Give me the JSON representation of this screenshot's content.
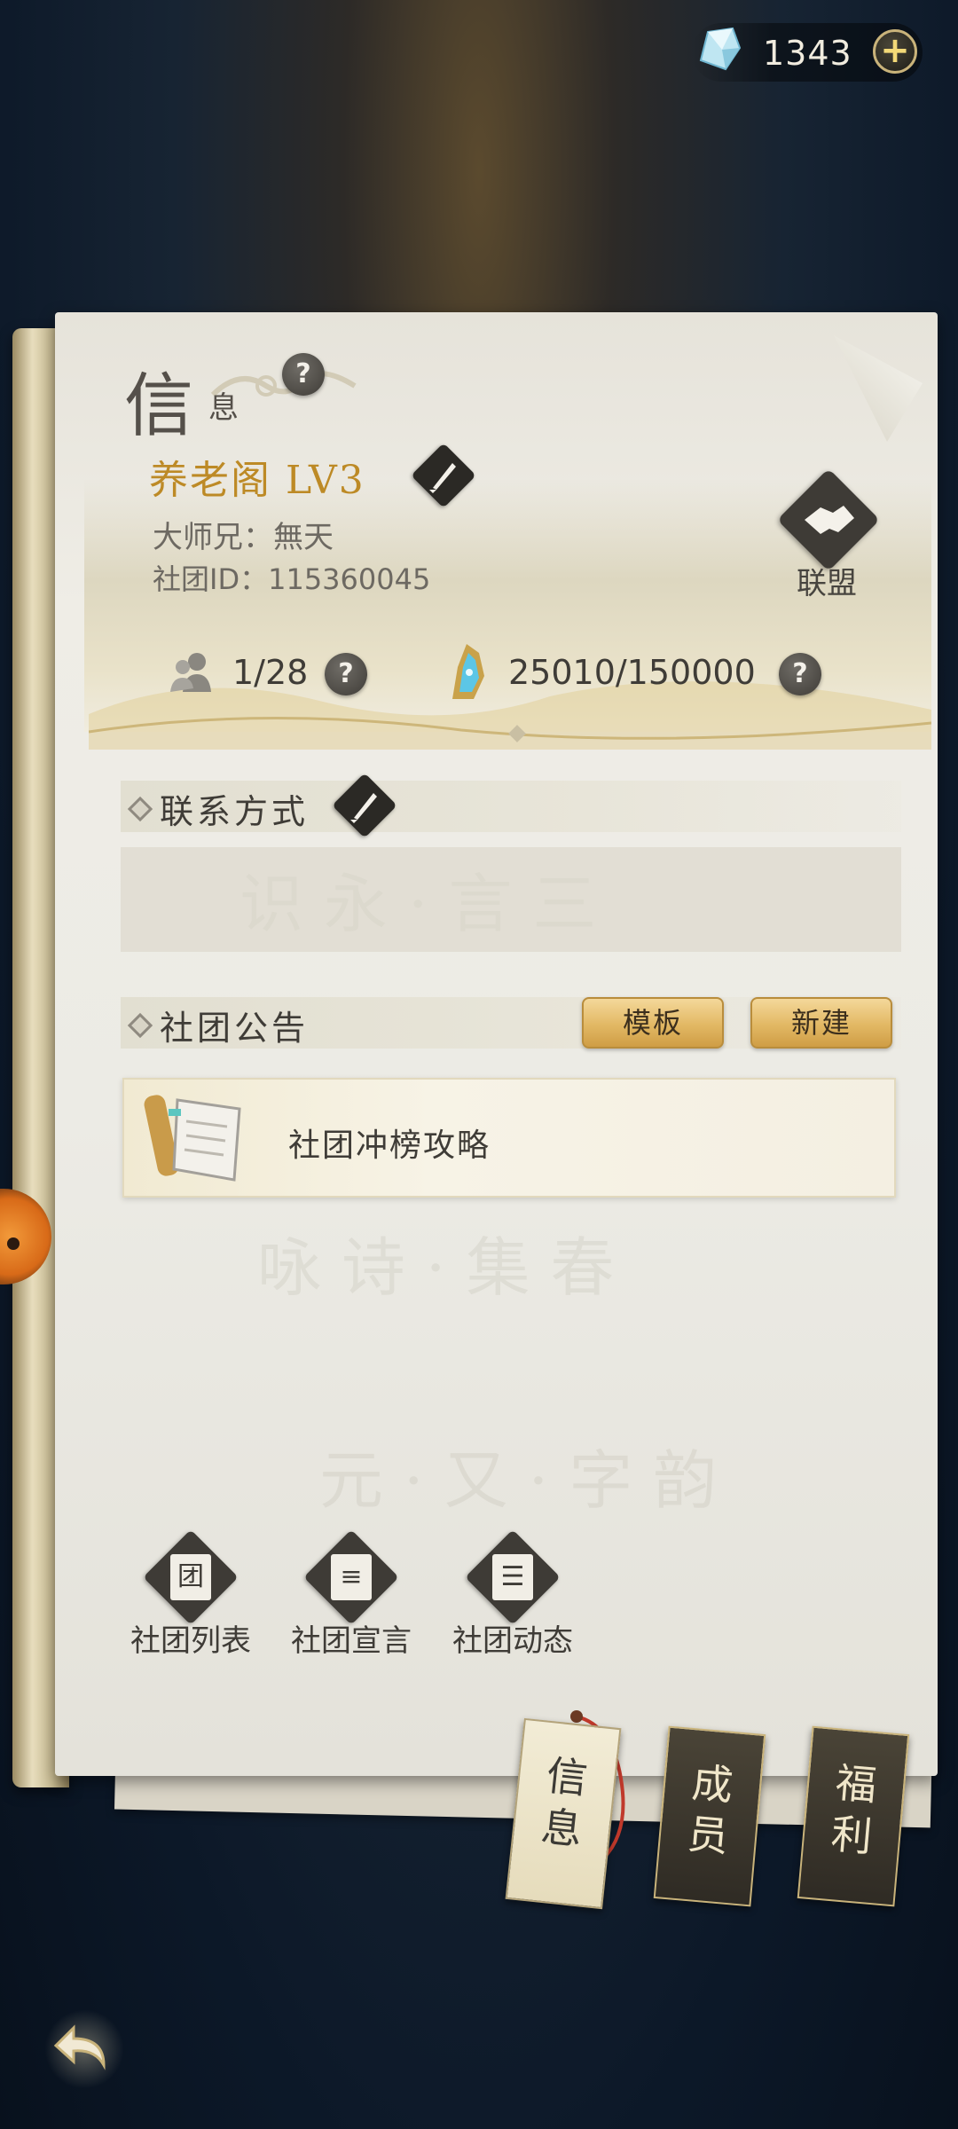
{
  "currency": {
    "value": "1343",
    "icon": "crystal-gem-icon",
    "add_icon": "plus-icon"
  },
  "panel": {
    "title_big": "信",
    "title_small": "息",
    "help_icon": "question-icon"
  },
  "club": {
    "name_level": "养老阁 LV3",
    "leader_label": "大师兄：",
    "leader_name": "無天",
    "id_label": "社团ID：",
    "id_value": "115360045",
    "alliance_label": "联盟",
    "members": "1/28",
    "experience": "25010/150000"
  },
  "contact": {
    "title": "联系方式",
    "text": ""
  },
  "notice": {
    "title": "社团公告",
    "template_button": "模板",
    "new_button": "新建",
    "items": [
      {
        "title": "社团冲榜攻略"
      }
    ]
  },
  "tools": [
    {
      "label": "社团列表",
      "glyph": "团",
      "icon": "club-list-icon"
    },
    {
      "label": "社团宣言",
      "glyph": "≡",
      "icon": "club-manifesto-icon"
    },
    {
      "label": "社团动态",
      "glyph": "☰",
      "icon": "club-news-icon"
    }
  ],
  "tabs": [
    {
      "line1": "信",
      "line2": "息",
      "active": true
    },
    {
      "line1": "成",
      "line2": "员",
      "active": false
    },
    {
      "line1": "福",
      "line2": "利",
      "active": false
    }
  ],
  "colors": {
    "accent_gold": "#bd8a26",
    "button_gold": "#e2b864",
    "ink": "#3f3c37"
  }
}
